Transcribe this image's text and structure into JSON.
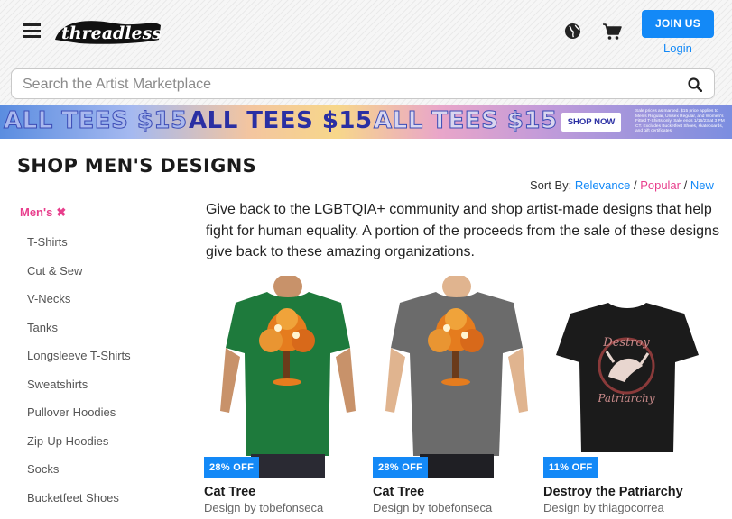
{
  "header": {
    "logo_text": "threadless",
    "join_label": "JOIN US",
    "login_label": "Login",
    "icons": [
      "menu-icon",
      "globe-icon",
      "cart-icon"
    ]
  },
  "search": {
    "placeholder": "Search the Artist Marketplace",
    "value": ""
  },
  "banner": {
    "promo_1": "ALL TEES $15",
    "promo_2": "ALL TEES $15",
    "promo_3": "ALL TEES $15",
    "cta": "SHOP NOW",
    "fine_print": "Sale prices as marked. $15 price applies to Men's Regular, Unisex Regular, and Women's Fitted T-Shirts only. Sale ends 1/16/23 at 3 PM CT. Excludes Bucketfeet Shoes, skateboards, and gift certificates."
  },
  "page": {
    "title": "SHOP MEN'S DESIGNS",
    "sort_label": "Sort By:",
    "sort_options": [
      "Relevance",
      "Popular",
      "New"
    ],
    "sort_sep": "/",
    "intro": "Give back to the LGBTQIA+ community and shop artist-made designs that help fight for human equality. A portion of the proceeds from the sale of these designs give back to these amazing organizations."
  },
  "sidebar": {
    "active_filter": "Men's",
    "remove_glyph": "✖",
    "items": [
      "T-Shirts",
      "Cut & Sew",
      "V-Necks",
      "Tanks",
      "Longsleeve T-Shirts",
      "Sweatshirts",
      "Pullover Hoodies",
      "Zip-Up Hoodies",
      "Socks",
      "Bucketfeet Shoes"
    ]
  },
  "products": [
    {
      "title": "Cat Tree",
      "artist": "Design by tobefonseca",
      "badge": "28% OFF",
      "shirt_color": "#1e7a3c"
    },
    {
      "title": "Cat Tree",
      "artist": "Design by tobefonseca",
      "badge": "28% OFF",
      "shirt_color": "#6b6b6b"
    },
    {
      "title": "Destroy the Patriarchy",
      "artist": "Design by thiagocorrea",
      "badge": "11% OFF",
      "shirt_color": "#1b1b1b",
      "print_text_1": "Destroy",
      "print_text_2": "Patriarchy"
    }
  ],
  "colors": {
    "accent_blue": "#1389f7",
    "accent_pink": "#e83e8c"
  }
}
